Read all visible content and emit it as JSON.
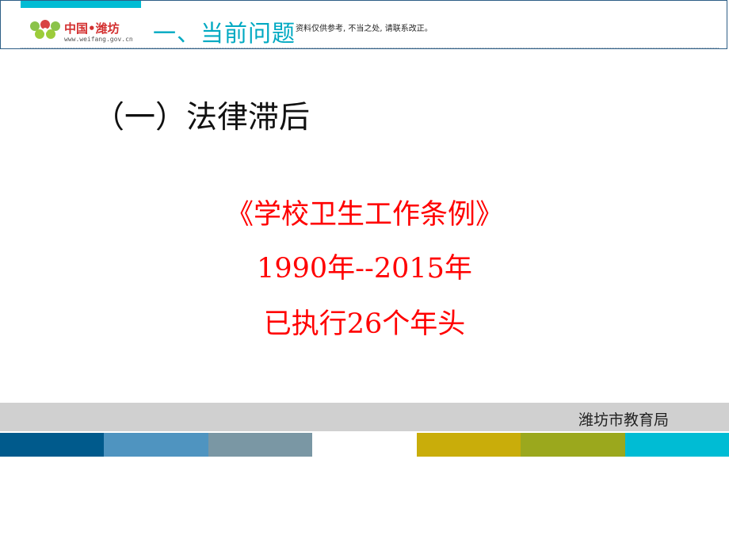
{
  "header": {
    "logo_title": "中国•潍坊",
    "logo_url": "www.weifang.gov.cn",
    "section_title": "一、当前问题",
    "disclaimer": "资料仅供参考, 不当之处, 请联系改正。",
    "accent_color": "#00bcd4"
  },
  "content": {
    "subheading": "（一）法律滞后",
    "lines": [
      "《学校卫生工作条例》",
      "1990年--2015年",
      "已执行26个年头"
    ],
    "text_color": "#ff0000"
  },
  "footer": {
    "org": "潍坊市教育局",
    "stripe_colors": [
      "#005a8c",
      "#4f94c0",
      "#7a97a4",
      "#ffffff",
      "#c9ad0a",
      "#9ba81d",
      "#00bcd4"
    ]
  }
}
